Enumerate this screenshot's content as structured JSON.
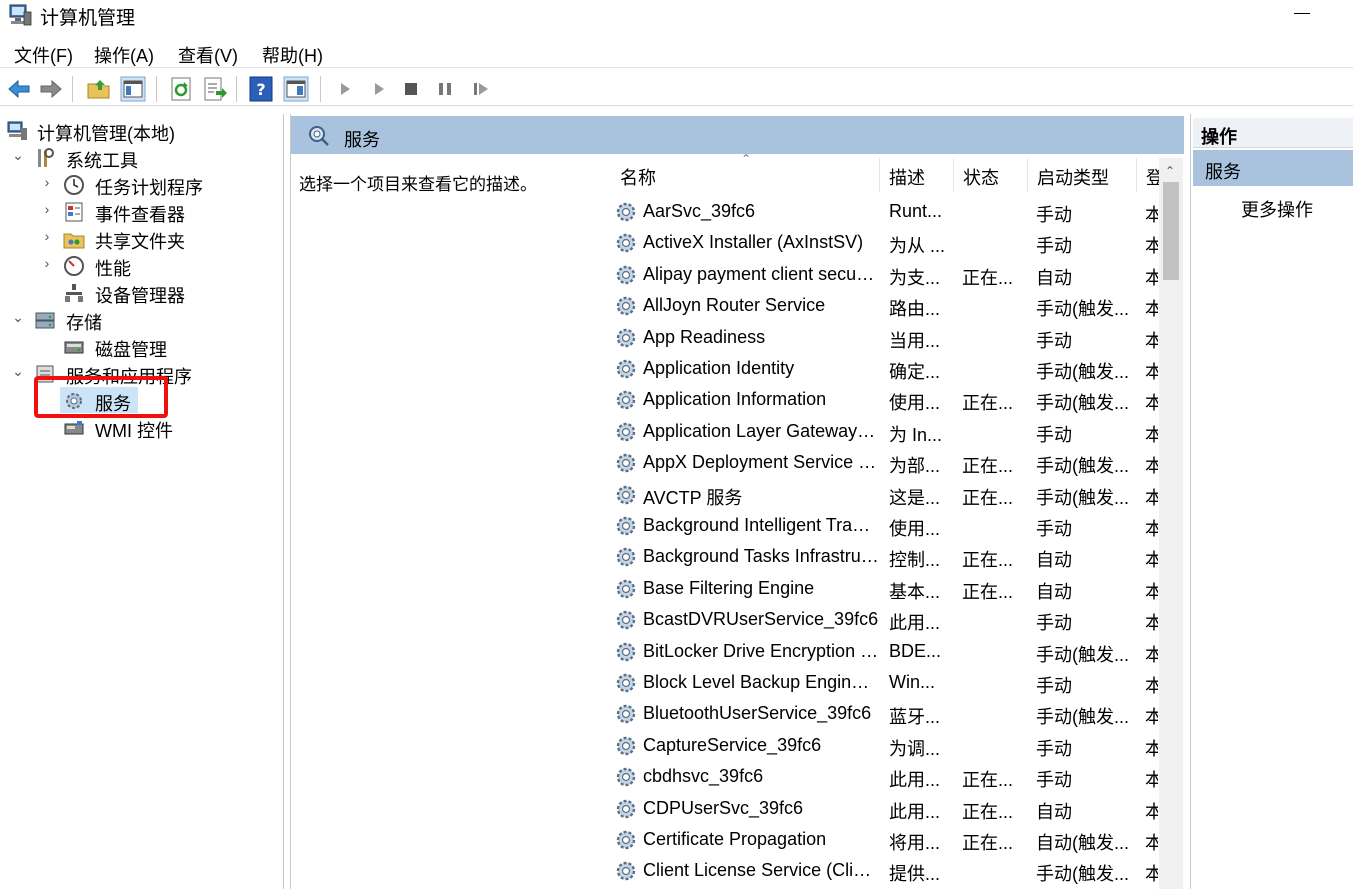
{
  "window": {
    "title": "计算机管理"
  },
  "menu": [
    "文件(F)",
    "操作(A)",
    "查看(V)",
    "帮助(H)"
  ],
  "toolbar": {
    "icons": [
      "back-arrow-icon",
      "forward-arrow-icon",
      "up-folder-icon",
      "show-tree-icon",
      "refresh-icon",
      "export-list-icon",
      "help-icon",
      "properties-icon",
      "start-service-icon",
      "start-service-alt-icon",
      "stop-service-icon",
      "pause-service-icon",
      "resume-service-icon"
    ]
  },
  "tree": {
    "root": "计算机管理(本地)",
    "system_tools": "系统工具",
    "task_scheduler": "任务计划程序",
    "event_viewer": "事件查看器",
    "shared_folders": "共享文件夹",
    "performance": "性能",
    "device_manager": "设备管理器",
    "storage": "存储",
    "disk_management": "磁盘管理",
    "services_apps": "服务和应用程序",
    "services": "服务",
    "wmi": "WMI 控件"
  },
  "center": {
    "header": "服务",
    "description_hint": "选择一个项目来查看它的描述。",
    "columns": {
      "name": "名称",
      "desc": "描述",
      "status": "状态",
      "startup": "启动类型",
      "logon": "登"
    },
    "services": [
      {
        "name": "AarSvc_39fc6",
        "desc": "Runt...",
        "status": "",
        "startup": "手动",
        "logon": "本"
      },
      {
        "name": "ActiveX Installer (AxInstSV)",
        "desc": "为从 ...",
        "status": "",
        "startup": "手动",
        "logon": "本"
      },
      {
        "name": "Alipay payment client security service",
        "desc": "为支...",
        "status": "正在...",
        "startup": "自动",
        "logon": "本"
      },
      {
        "name": "AllJoyn Router Service",
        "desc": "路由...",
        "status": "",
        "startup": "手动(触发...",
        "logon": "本"
      },
      {
        "name": "App Readiness",
        "desc": "当用...",
        "status": "",
        "startup": "手动",
        "logon": "本"
      },
      {
        "name": "Application Identity",
        "desc": "确定...",
        "status": "",
        "startup": "手动(触发...",
        "logon": "本"
      },
      {
        "name": "Application Information",
        "desc": "使用...",
        "status": "正在...",
        "startup": "手动(触发...",
        "logon": "本"
      },
      {
        "name": "Application Layer Gateway Service",
        "desc": "为 In...",
        "status": "",
        "startup": "手动",
        "logon": "本"
      },
      {
        "name": "AppX Deployment Service (AppXSVC)",
        "desc": "为部...",
        "status": "正在...",
        "startup": "手动(触发...",
        "logon": "本"
      },
      {
        "name": "AVCTP 服务",
        "desc": "这是...",
        "status": "正在...",
        "startup": "手动(触发...",
        "logon": "本"
      },
      {
        "name": "Background Intelligent Transfer Service",
        "desc": "使用...",
        "status": "",
        "startup": "手动",
        "logon": "本"
      },
      {
        "name": "Background Tasks Infrastructure Service",
        "desc": "控制...",
        "status": "正在...",
        "startup": "自动",
        "logon": "本"
      },
      {
        "name": "Base Filtering Engine",
        "desc": "基本...",
        "status": "正在...",
        "startup": "自动",
        "logon": "本"
      },
      {
        "name": "BcastDVRUserService_39fc6",
        "desc": "此用...",
        "status": "",
        "startup": "手动",
        "logon": "本"
      },
      {
        "name": "BitLocker Drive Encryption Service",
        "desc": "BDE...",
        "status": "",
        "startup": "手动(触发...",
        "logon": "本"
      },
      {
        "name": "Block Level Backup Engine Service",
        "desc": "Win...",
        "status": "",
        "startup": "手动",
        "logon": "本"
      },
      {
        "name": "BluetoothUserService_39fc6",
        "desc": "蓝牙...",
        "status": "",
        "startup": "手动(触发...",
        "logon": "本"
      },
      {
        "name": "CaptureService_39fc6",
        "desc": "为调...",
        "status": "",
        "startup": "手动",
        "logon": "本"
      },
      {
        "name": "cbdhsvc_39fc6",
        "desc": "此用...",
        "status": "正在...",
        "startup": "手动",
        "logon": "本"
      },
      {
        "name": "CDPUserSvc_39fc6",
        "desc": "此用...",
        "status": "正在...",
        "startup": "自动",
        "logon": "本"
      },
      {
        "name": "Certificate Propagation",
        "desc": "将用...",
        "status": "正在...",
        "startup": "自动(触发...",
        "logon": "本"
      },
      {
        "name": "Client License Service (ClipSVC)",
        "desc": "提供...",
        "status": "",
        "startup": "手动(触发...",
        "logon": "本"
      }
    ]
  },
  "actions": {
    "header": "操作",
    "section": "服务",
    "more": "更多操作"
  },
  "colors": {
    "header_blue": "#a9c3de",
    "selection": "#cce4f7",
    "highlight_red": "#f01010"
  }
}
